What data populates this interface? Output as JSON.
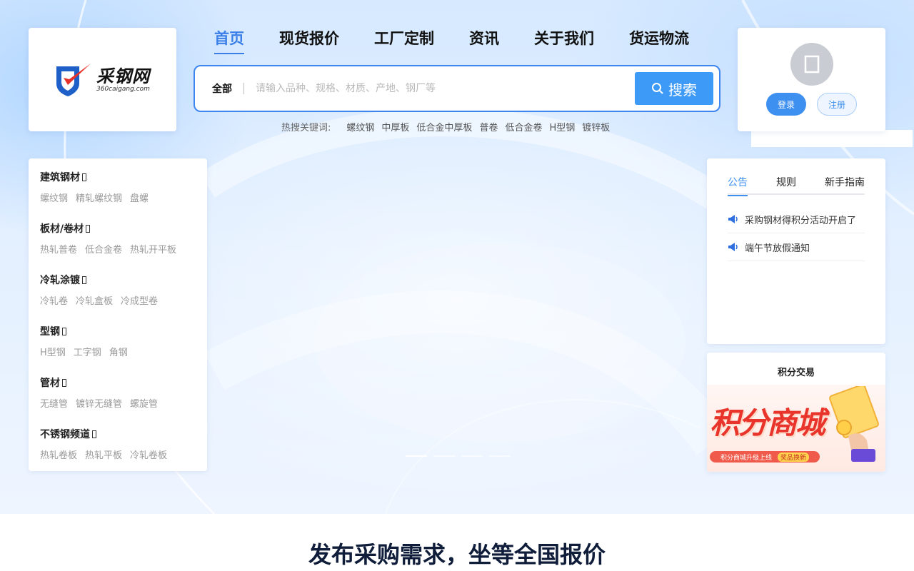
{
  "logo": {
    "name": "采钢网",
    "domain": "360caigang.com"
  },
  "nav": [
    {
      "label": "首页",
      "active": true
    },
    {
      "label": "现货报价",
      "active": false
    },
    {
      "label": "工厂定制",
      "active": false
    },
    {
      "label": "资讯",
      "active": false
    },
    {
      "label": "关于我们",
      "active": false
    },
    {
      "label": "货运物流",
      "active": false
    }
  ],
  "search": {
    "scope": "全部",
    "placeholder": "请输入品种、规格、材质、产地、钢厂等",
    "button_label": "搜索",
    "button_icon": "search-icon"
  },
  "hot_keywords": {
    "label": "热搜关键词:",
    "items": [
      "螺纹钢",
      "中厚板",
      "低合金中厚板",
      "普卷",
      "低合金卷",
      "H型钢",
      "镀锌板"
    ]
  },
  "user": {
    "avatar_icon": "user-icon",
    "login_label": "登录",
    "register_label": "注册"
  },
  "categories": [
    {
      "title": "建筑钢材",
      "items": [
        "螺纹钢",
        "精轧螺纹钢",
        "盘螺"
      ]
    },
    {
      "title": "板材/卷材",
      "items": [
        "热轧普卷",
        "低合金卷",
        "热轧开平板"
      ]
    },
    {
      "title": "冷轧涂镀",
      "items": [
        "冷轧卷",
        "冷轧盒板",
        "冷成型卷"
      ]
    },
    {
      "title": "型钢",
      "items": [
        "H型钢",
        "工字钢",
        "角钢"
      ]
    },
    {
      "title": "管材",
      "items": [
        "无缝管",
        "镀锌无缝管",
        "螺旋管"
      ]
    },
    {
      "title": "不锈钢频道",
      "items": [
        "热轧卷板",
        "热轧平板",
        "冷轧卷板"
      ]
    }
  ],
  "carousel": {
    "slide_count": 4,
    "active_index": 0
  },
  "notice": {
    "tabs": [
      {
        "label": "公告",
        "active": true
      },
      {
        "label": "规则",
        "active": false
      },
      {
        "label": "新手指南",
        "active": false
      }
    ],
    "items": [
      "采购钢材得积分活动开启了",
      "端午节放假通知"
    ],
    "item_icon": "megaphone-icon"
  },
  "points": {
    "title": "积分交易",
    "banner_text": "积分商城",
    "strip_text": "积分商城升级上线",
    "strip_highlight": "奖品换新"
  },
  "bottom": {
    "title": "发布采购需求，坐等全国报价"
  },
  "colors": {
    "accent": "#3d8ff0",
    "search_button": "#3d9bf7",
    "points_red": "#e8342a"
  }
}
